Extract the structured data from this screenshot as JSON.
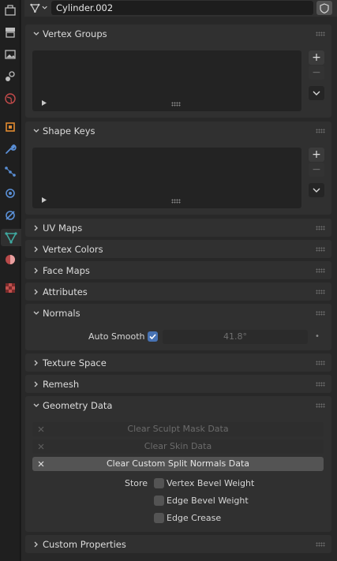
{
  "header": {
    "object_name": "Cylinder.002",
    "data_type_icon": "mesh-data-icon",
    "fake_user_icon": "shield-icon"
  },
  "tabs": [
    {
      "name": "tool-tab",
      "icon": "tool-icon"
    },
    {
      "name": "render-tab",
      "icon": "render-icon"
    },
    {
      "name": "output-tab",
      "icon": "output-icon"
    },
    {
      "name": "view-layer-tab",
      "icon": "view-layer-icon"
    },
    {
      "name": "scene-tab",
      "icon": "scene-icon"
    },
    {
      "name": "world-tab",
      "icon": "world-icon"
    },
    {
      "name": "object-tab",
      "icon": "object-icon"
    },
    {
      "name": "modifiers-tab",
      "icon": "wrench-icon"
    },
    {
      "name": "particles-tab",
      "icon": "particles-icon"
    },
    {
      "name": "physics-tab",
      "icon": "physics-icon"
    },
    {
      "name": "constraints-tab",
      "icon": "constraints-icon"
    },
    {
      "name": "data-tab",
      "icon": "mesh-data-icon",
      "active": true
    },
    {
      "name": "material-tab",
      "icon": "material-icon"
    },
    {
      "name": "texture-tab",
      "icon": "texture-icon"
    }
  ],
  "panels": {
    "vertex_groups": {
      "title": "Vertex Groups",
      "expanded": true
    },
    "shape_keys": {
      "title": "Shape Keys",
      "expanded": true
    },
    "uv_maps": {
      "title": "UV Maps",
      "expanded": false
    },
    "vertex_colors": {
      "title": "Vertex Colors",
      "expanded": false
    },
    "face_maps": {
      "title": "Face Maps",
      "expanded": false
    },
    "attributes": {
      "title": "Attributes",
      "expanded": false
    },
    "normals": {
      "title": "Normals",
      "expanded": true,
      "auto_smooth_label": "Auto Smooth",
      "auto_smooth_checked": true,
      "angle_value": "41.8°",
      "angle_unit": "•"
    },
    "texture_space": {
      "title": "Texture Space",
      "expanded": false
    },
    "remesh": {
      "title": "Remesh",
      "expanded": false
    },
    "geometry_data": {
      "title": "Geometry Data",
      "expanded": true,
      "clear_sculpt_mask": "Clear Sculpt Mask Data",
      "clear_skin": "Clear Skin Data",
      "clear_custom_split_normals": "Clear Custom Split Normals Data",
      "store_label": "Store",
      "vertex_bevel_weight": "Vertex Bevel Weight",
      "edge_bevel_weight": "Edge Bevel Weight",
      "edge_crease": "Edge Crease"
    },
    "custom_properties": {
      "title": "Custom Properties",
      "expanded": false
    }
  },
  "list_buttons": {
    "add": "+",
    "remove": "−"
  },
  "colors": {
    "panel_bg": "#303030",
    "editor_bg": "#282828",
    "accent_checkbox": "#4772b3",
    "data_tab_icon": "#3fa9a0"
  }
}
